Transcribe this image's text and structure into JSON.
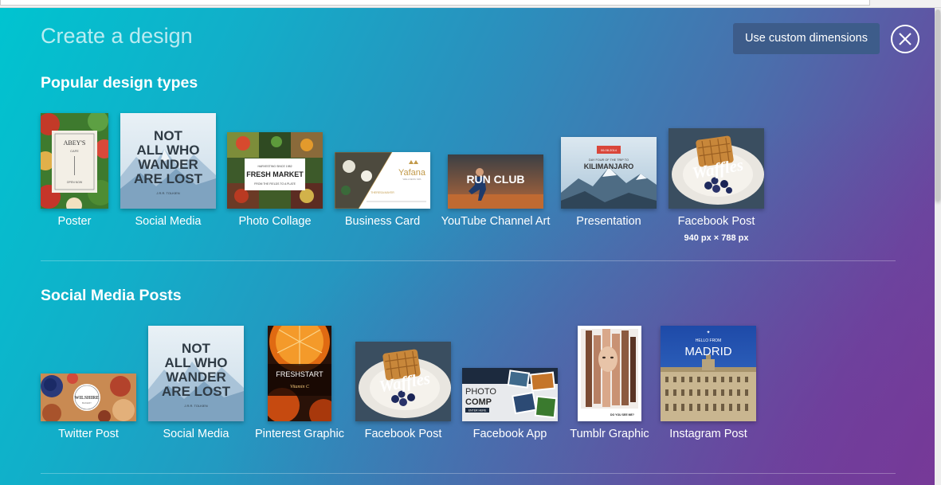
{
  "window": {
    "title": "Create a design"
  },
  "header": {
    "custom_dimensions_label": "Use custom dimensions"
  },
  "sections": [
    {
      "title": "Popular design types",
      "items": [
        {
          "label": "Poster"
        },
        {
          "label": "Social Media"
        },
        {
          "label": "Photo Collage"
        },
        {
          "label": "Business Card"
        },
        {
          "label": "YouTube Channel Art"
        },
        {
          "label": "Presentation"
        },
        {
          "label": "Facebook Post",
          "sublabel": "940 px × 788 px"
        }
      ]
    },
    {
      "title": "Social Media Posts",
      "items": [
        {
          "label": "Twitter Post"
        },
        {
          "label": "Social Media"
        },
        {
          "label": "Pinterest Graphic"
        },
        {
          "label": "Facebook Post"
        },
        {
          "label": "Facebook App"
        },
        {
          "label": "Tumblr Graphic"
        },
        {
          "label": "Instagram Post"
        }
      ]
    }
  ],
  "thumbnail_text": {
    "poster": {
      "line1": "ABEY'S",
      "line2": "CAFE",
      "line3": "OPEN NOW"
    },
    "quote": {
      "line1": "NOT",
      "line2": "ALL WHO",
      "line3": "WANDER",
      "line4": "ARE LOST",
      "author": "J.R.R. TOLKIEN"
    },
    "collage": {
      "line1": "FRESH MARKET",
      "line2": "HARVESTING SINCE 1982",
      "line3": "FROM THE FIELDS TO A PLATE"
    },
    "card": {
      "brand": "Yafana",
      "tag": "WELLNESS SPA",
      "name": "THERESA MAYER"
    },
    "youtube": {
      "title": "RUN CLUB"
    },
    "presentation": {
      "badge": "06.08.2014",
      "line1": "DAY FOUR OF THE TRIP TO",
      "line2": "KILIMANJARO"
    },
    "waffles": {
      "title": "Waffles"
    },
    "twitter": {
      "title": "WILSHIRE",
      "sub": "BAKERY"
    },
    "pinterest": {
      "title": "FRESHSTART",
      "sub": "Vitamin C"
    },
    "app": {
      "line1": "PHOTO",
      "line2": "COMP",
      "cta": "ENTER HERE"
    },
    "tumblr": {
      "caption": "DO YOU SEE ME?"
    },
    "instagram": {
      "line1": "HELLO FROM",
      "line2": "MADRID"
    }
  },
  "colors": {
    "gradient_start": "#00c4d0",
    "gradient_end": "#74409a",
    "button_bg": "#3d5c8a",
    "text": "#ffffff"
  },
  "icons": {
    "close": "close-icon"
  }
}
